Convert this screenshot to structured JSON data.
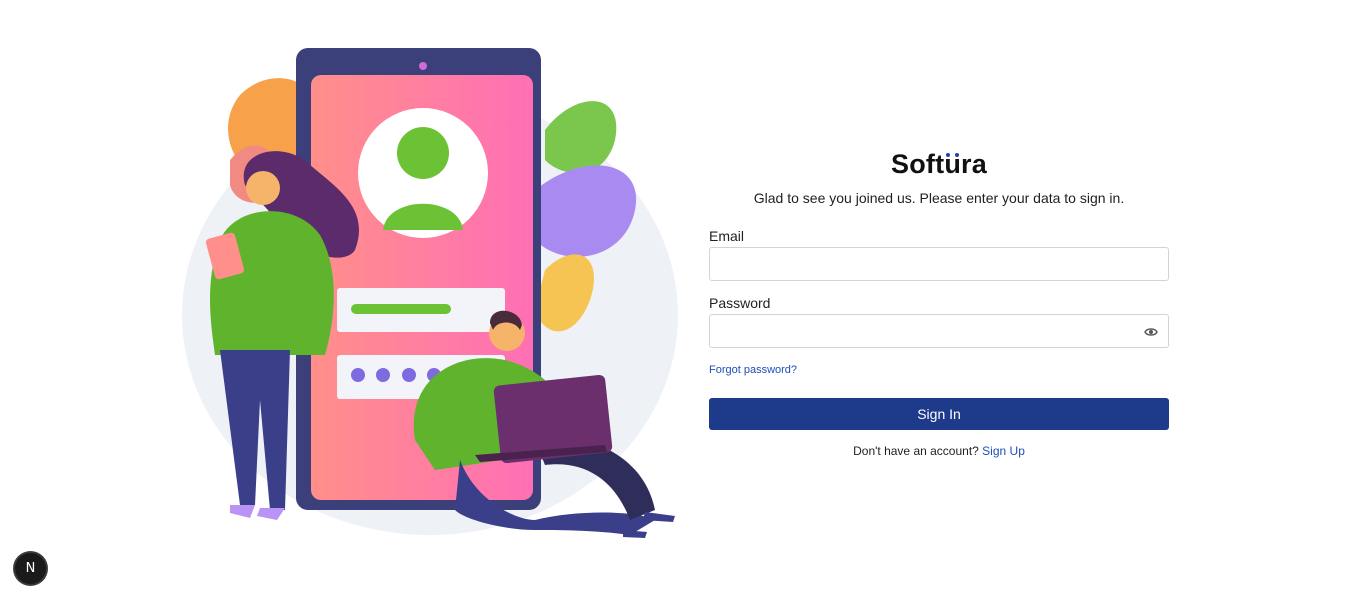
{
  "brand": {
    "logo_prefix": "Soft",
    "logo_mark": "u",
    "logo_suffix": "ra",
    "accent_color": "#1e3a8a",
    "link_color": "#1d4fb8"
  },
  "login": {
    "subtitle": "Glad to see you joined us. Please enter your data to sign in.",
    "email_label": "Email",
    "email_value": "",
    "password_label": "Password",
    "password_value": "",
    "password_toggle_icon": "eye-icon",
    "forgot_link": "Forgot password?",
    "submit_label": "Sign In",
    "signup_prompt": "Don't have an account?",
    "signup_link": "Sign Up"
  },
  "illustration": {
    "description_icon": "login-illustration"
  },
  "dev_badge": {
    "letter": "N",
    "icon": "nextjs-icon"
  }
}
